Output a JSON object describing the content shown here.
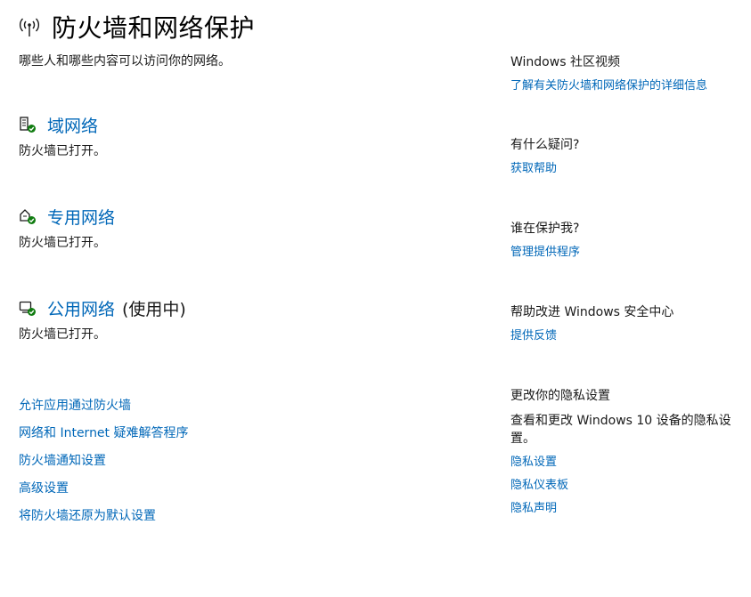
{
  "header": {
    "title": "防火墙和网络保护",
    "subtitle": "哪些人和哪些内容可以访问你的网络。",
    "icon": "wifi-antenna-icon"
  },
  "networks": [
    {
      "title": "域网络",
      "status": "防火墙已打开。",
      "in_use": "",
      "icon": "domain-network-icon"
    },
    {
      "title": "专用网络",
      "status": "防火墙已打开。",
      "in_use": "",
      "icon": "private-network-icon"
    },
    {
      "title": "公用网络",
      "status": "防火墙已打开。",
      "in_use": "(使用中)",
      "icon": "public-network-icon"
    }
  ],
  "links": [
    "允许应用通过防火墙",
    "网络和 Internet 疑难解答程序",
    "防火墙通知设置",
    "高级设置",
    "将防火墙还原为默认设置"
  ],
  "sidebar": {
    "community": {
      "heading": "Windows 社区视频",
      "link": "了解有关防火墙和网络保护的详细信息"
    },
    "question": {
      "heading": "有什么疑问?",
      "link": "获取帮助"
    },
    "protect": {
      "heading": "谁在保护我?",
      "link": "管理提供程序"
    },
    "improve": {
      "heading": "帮助改进 Windows 安全中心",
      "link": "提供反馈"
    },
    "privacy": {
      "heading": "更改你的隐私设置",
      "text": "查看和更改 Windows 10 设备的隐私设置。",
      "links": [
        "隐私设置",
        "隐私仪表板",
        "隐私声明"
      ]
    }
  },
  "colors": {
    "link": "#0067b8",
    "check": "#107c10",
    "text": "#1a1a1a"
  }
}
